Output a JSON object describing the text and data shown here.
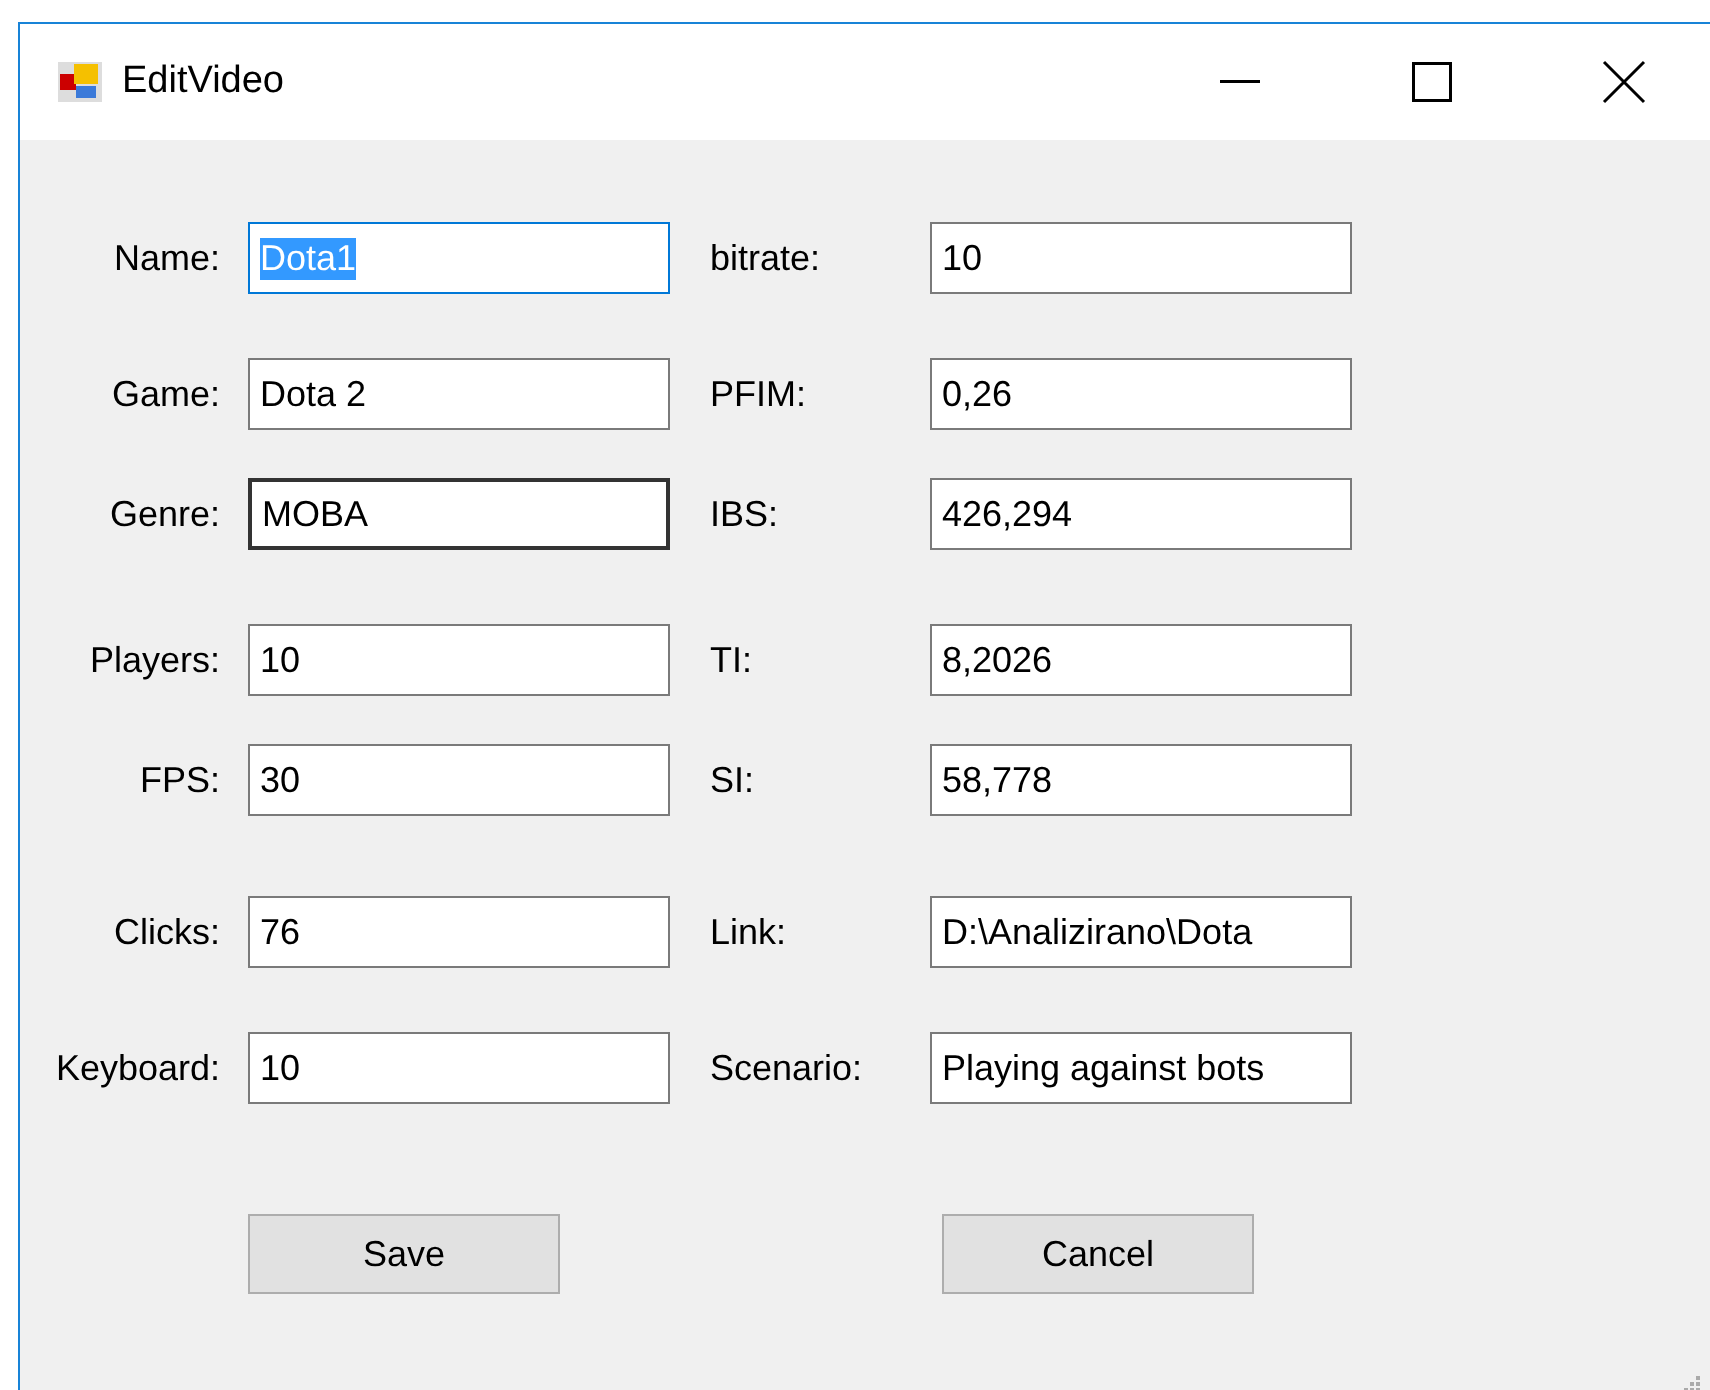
{
  "window": {
    "title": "EditVideo"
  },
  "rows": [
    {
      "left": {
        "label": "Name:",
        "value": "Dota1",
        "focused": true,
        "hovered": false
      },
      "right": {
        "label": "bitrate:",
        "value": "10",
        "focused": false,
        "hovered": false
      }
    },
    {
      "left": {
        "label": "Game:",
        "value": "Dota 2",
        "focused": false,
        "hovered": false
      },
      "right": {
        "label": "PFIM:",
        "value": "0,26",
        "focused": false,
        "hovered": false
      }
    },
    {
      "left": {
        "label": "Genre:",
        "value": "MOBA",
        "focused": false,
        "hovered": true
      },
      "right": {
        "label": "IBS:",
        "value": "426,294",
        "focused": false,
        "hovered": false
      }
    },
    {
      "left": {
        "label": "Players:",
        "value": "10",
        "focused": false,
        "hovered": false
      },
      "right": {
        "label": "TI:",
        "value": "8,2026",
        "focused": false,
        "hovered": false
      }
    },
    {
      "left": {
        "label": "FPS:",
        "value": "30",
        "focused": false,
        "hovered": false
      },
      "right": {
        "label": "SI:",
        "value": "58,778",
        "focused": false,
        "hovered": false
      }
    },
    {
      "left": {
        "label": "Clicks:",
        "value": "76",
        "focused": false,
        "hovered": false
      },
      "right": {
        "label": "Link:",
        "value": "D:\\Analizirano\\Dota",
        "focused": false,
        "hovered": false
      }
    },
    {
      "left": {
        "label": "Keyboard:",
        "value": "10",
        "focused": false,
        "hovered": false
      },
      "right": {
        "label": "Scenario:",
        "value": "Playing against bots",
        "focused": false,
        "hovered": false
      }
    }
  ],
  "buttons": [
    "Save",
    "Cancel"
  ]
}
